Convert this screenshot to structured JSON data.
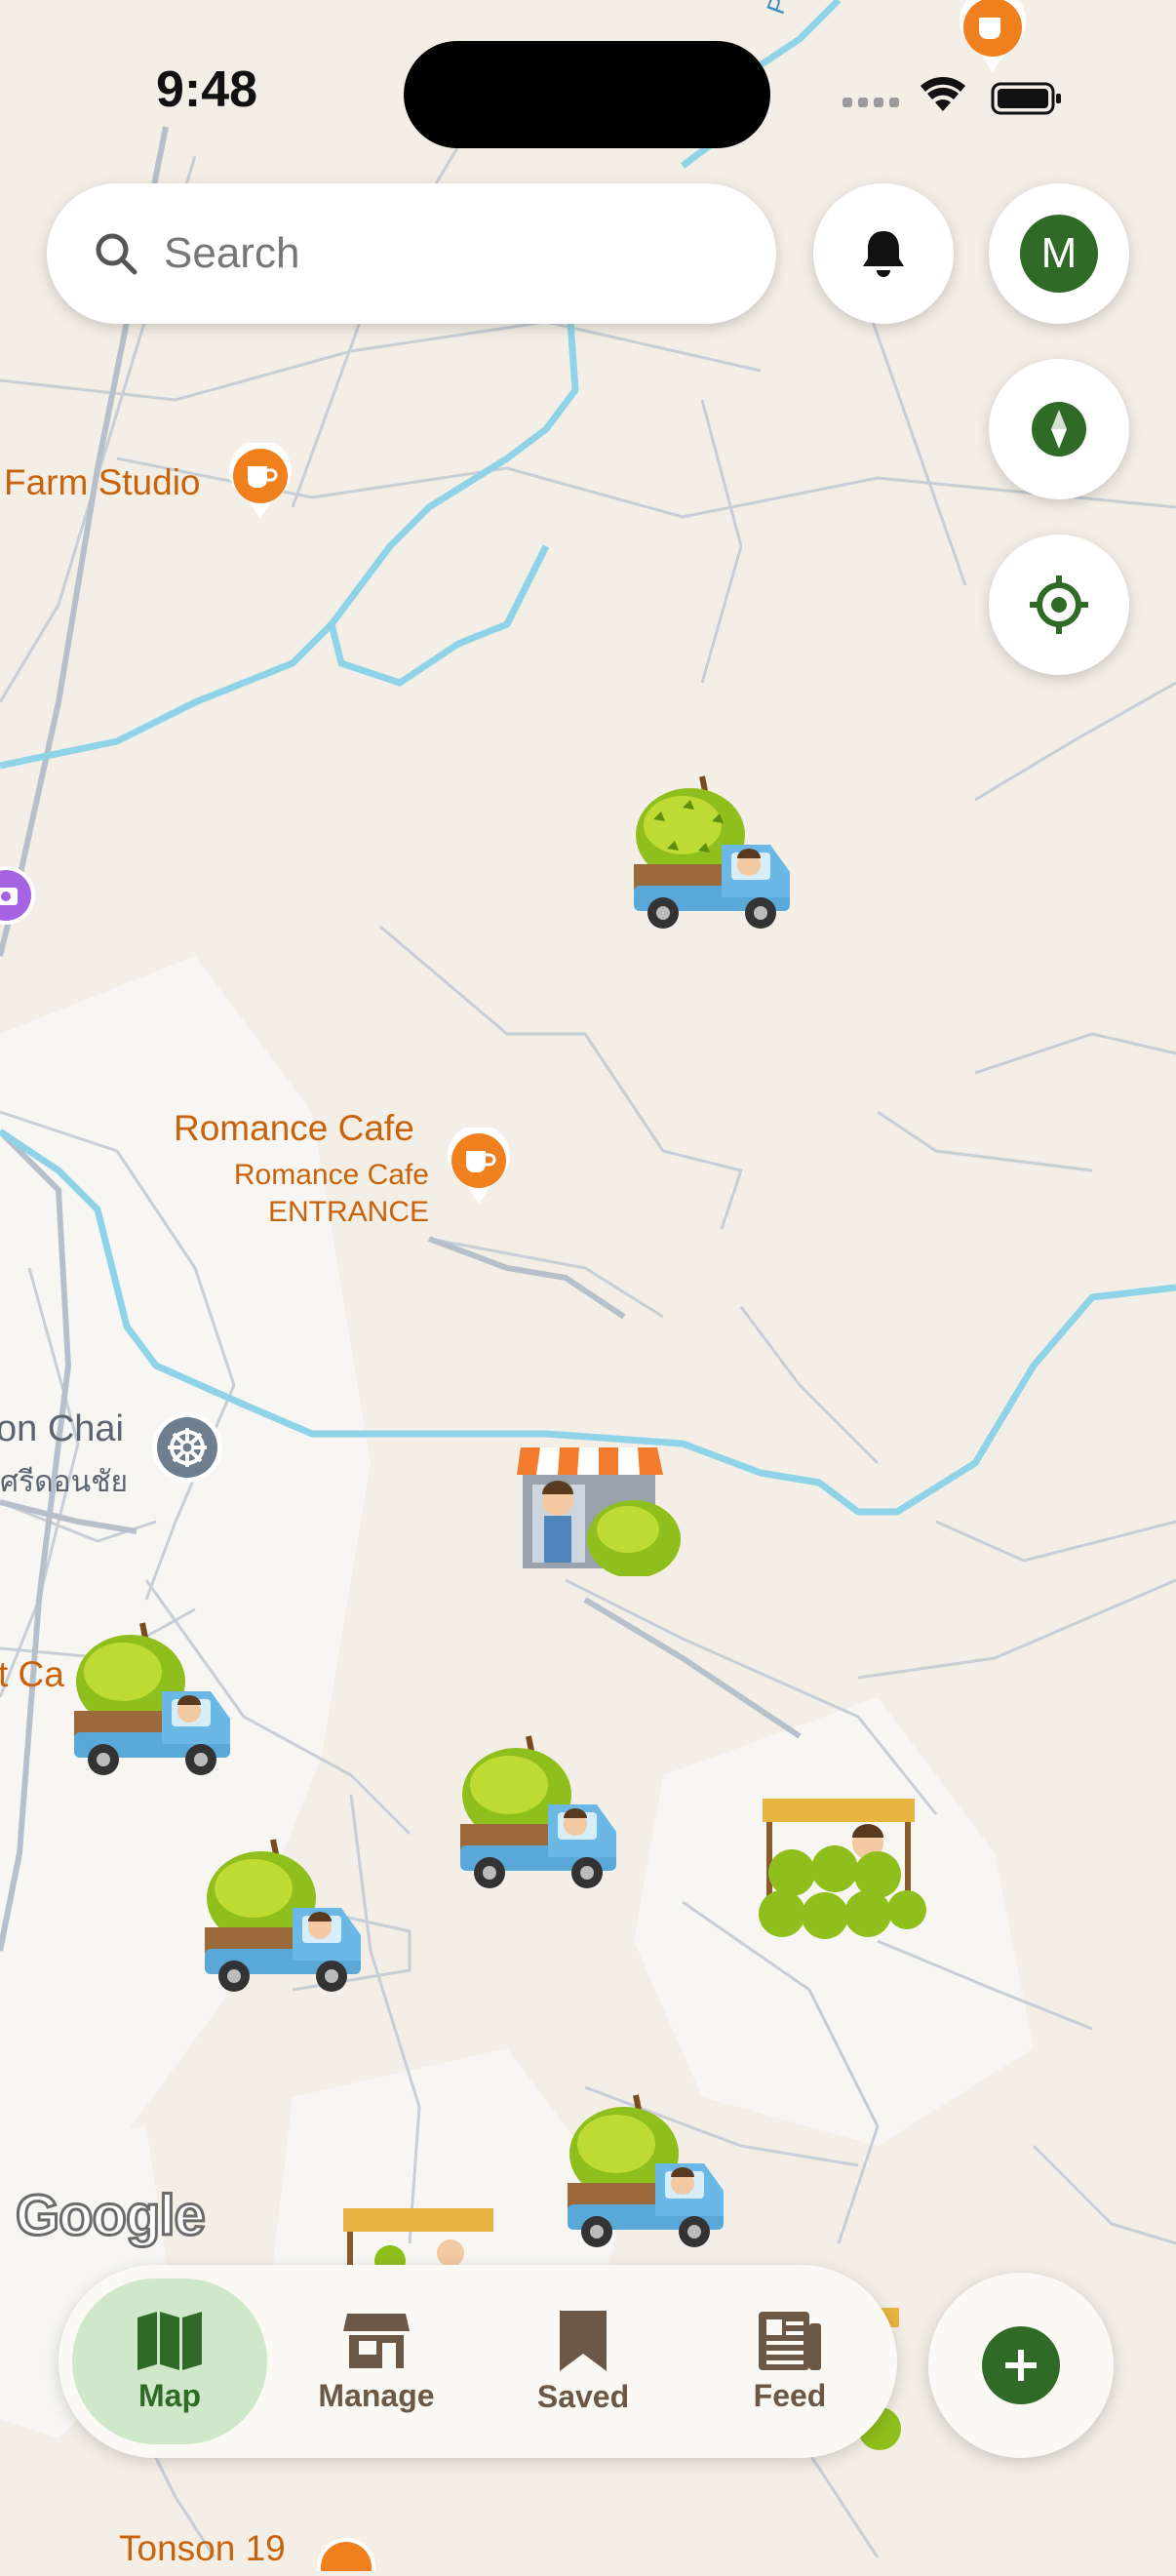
{
  "status": {
    "time": "9:48"
  },
  "search": {
    "placeholder": "Search"
  },
  "header": {
    "avatar_initial": "M"
  },
  "map_labels": {
    "farm_studio": "Farm Studio",
    "romance_cafe": "Romance Cafe",
    "romance_cafe_entrance_1": "Romance Cafe",
    "romance_cafe_entrance_2": "ENTRANCE",
    "don_chai": "on Chai",
    "don_chai_thai": "ศรีดอนชัย",
    "partial_cafe": "t Ca",
    "road_top": "Phraba",
    "tonson": "Tonson 19",
    "attribution": "Google"
  },
  "tabs": [
    {
      "label": "Map",
      "icon": "map-icon",
      "active": true
    },
    {
      "label": "Manage",
      "icon": "store-icon",
      "active": false
    },
    {
      "label": "Saved",
      "icon": "bookmark-icon",
      "active": false
    },
    {
      "label": "Feed",
      "icon": "newspaper-icon",
      "active": false
    }
  ],
  "colors": {
    "accent": "#2f6b27",
    "tab_active_bg": "#cfe8c9",
    "poi_orange": "#f07f1e",
    "river": "#8fd3e8"
  }
}
